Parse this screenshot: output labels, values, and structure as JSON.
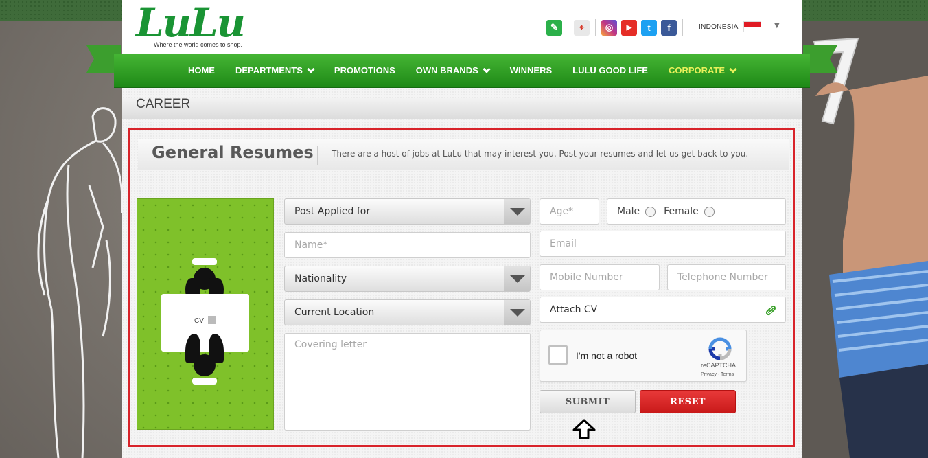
{
  "brand": {
    "logo_text": "LuLu",
    "tagline": "Where the world comes to shop."
  },
  "header": {
    "icons": [
      {
        "name": "feedback-icon",
        "glyph": "✎",
        "color": "#2bb04a"
      },
      {
        "name": "map-pin-icon",
        "glyph": "⌖",
        "color": "#e9e9e9"
      },
      {
        "name": "instagram-icon",
        "glyph": "◎",
        "color": "#c13584"
      },
      {
        "name": "youtube-icon",
        "glyph": "▶",
        "color": "#e52d27"
      },
      {
        "name": "twitter-icon",
        "glyph": "t",
        "color": "#1da1f2"
      },
      {
        "name": "facebook-icon",
        "glyph": "f",
        "color": "#3b5998"
      }
    ],
    "country": "INDONESIA"
  },
  "nav": {
    "items": [
      {
        "label": "HOME",
        "dropdown": false
      },
      {
        "label": "DEPARTMENTS",
        "dropdown": true
      },
      {
        "label": "PROMOTIONS",
        "dropdown": false
      },
      {
        "label": "OWN BRANDS",
        "dropdown": true
      },
      {
        "label": "WINNERS",
        "dropdown": false
      },
      {
        "label": "LULU GOOD LIFE",
        "dropdown": false
      },
      {
        "label": "CORPORATE",
        "dropdown": true,
        "active": true
      }
    ]
  },
  "career": {
    "title": "CAREER"
  },
  "resumes": {
    "title": "General Resumes",
    "description": "There are a host of jobs at LuLu that may interest you. Post your resumes and let us get back to you.",
    "cv_label": "CV"
  },
  "form": {
    "post_applied": "Post Applied for",
    "name_placeholder": "Name*",
    "nationality": "Nationality",
    "current_location": "Current Location",
    "covering_letter_placeholder": "Covering letter",
    "age_placeholder": "Age*",
    "gender_male": "Male",
    "gender_female": "Female",
    "email_placeholder": "Email",
    "mobile_placeholder": "Mobile Number",
    "telephone_placeholder": "Telephone Number",
    "attach_cv": "Attach CV",
    "captcha_text": "I'm not a robot",
    "captcha_brand": "reCAPTCHA",
    "captcha_links": "Privacy - Terms",
    "submit_label": "SUBMIT",
    "reset_label": "RESET"
  },
  "colors": {
    "brand_green": "#1a9434",
    "nav_green": "#2e9e22",
    "accent_red": "#d8232a",
    "active_nav": "#e8f05a"
  }
}
